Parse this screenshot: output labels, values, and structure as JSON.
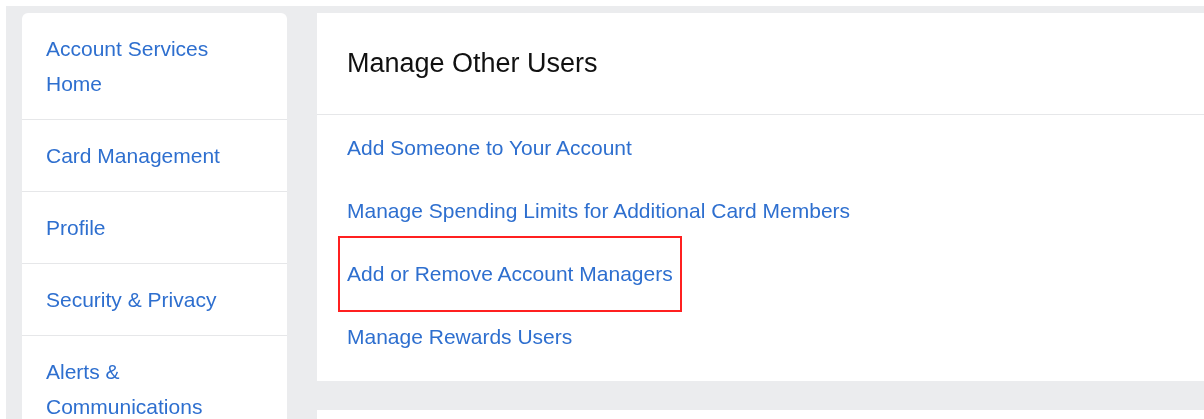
{
  "sidebar": {
    "items": [
      {
        "label": "Account Services Home"
      },
      {
        "label": "Card Management"
      },
      {
        "label": "Profile"
      },
      {
        "label": "Security & Privacy"
      },
      {
        "label": "Alerts & Communications"
      }
    ]
  },
  "panel": {
    "title": "Manage Other Users",
    "links": [
      {
        "label": "Add Someone to Your Account",
        "highlighted": false
      },
      {
        "label": "Manage Spending Limits for Additional Card Members",
        "highlighted": false
      },
      {
        "label": "Add or Remove Account Managers",
        "highlighted": true
      },
      {
        "label": "Manage Rewards Users",
        "highlighted": false
      }
    ]
  }
}
